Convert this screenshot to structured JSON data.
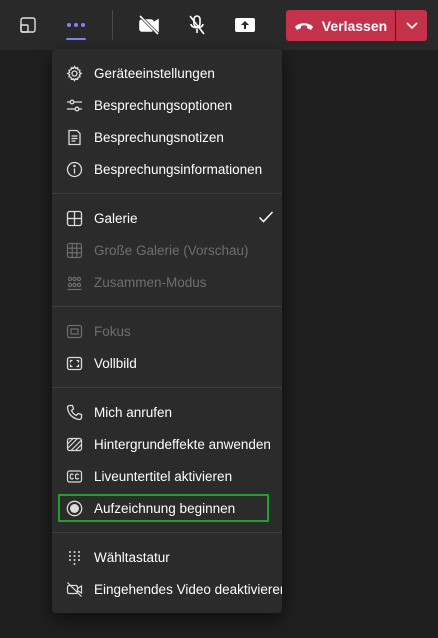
{
  "toolbar": {
    "leave_label": "Verlassen",
    "accent_color": "#7f85f5",
    "leave_color": "#c4314b",
    "icons": [
      "share-screen-icon",
      "more-options-icon",
      "camera-off-icon",
      "mic-off-icon",
      "share-tray-icon",
      "phone-hangup-icon",
      "chevron-down-icon"
    ]
  },
  "menu": {
    "groups": [
      [
        {
          "label": "Geräteeinstellungen",
          "icon": "gear-icon",
          "disabled": false
        },
        {
          "label": "Besprechungsoptionen",
          "icon": "sliders-icon",
          "disabled": false
        },
        {
          "label": "Besprechungsnotizen",
          "icon": "notes-icon",
          "disabled": false
        },
        {
          "label": "Besprechungsinformationen",
          "icon": "info-icon",
          "disabled": false
        }
      ],
      [
        {
          "label": "Galerie",
          "icon": "grid-icon",
          "disabled": false,
          "checked": true
        },
        {
          "label": "Große Galerie (Vorschau)",
          "icon": "large-grid-icon",
          "disabled": true
        },
        {
          "label": "Zusammen-Modus",
          "icon": "people-icon",
          "disabled": true
        }
      ],
      [
        {
          "label": "Fokus",
          "icon": "focus-icon",
          "disabled": true
        },
        {
          "label": "Vollbild",
          "icon": "fullscreen-icon",
          "disabled": false
        }
      ],
      [
        {
          "label": "Mich anrufen",
          "icon": "phone-icon",
          "disabled": false
        },
        {
          "label": "Hintergrundeffekte anwenden",
          "icon": "background-effects-icon",
          "disabled": false
        },
        {
          "label": "Liveuntertitel aktivieren",
          "icon": "captions-icon",
          "disabled": false
        },
        {
          "label": "Aufzeichnung beginnen",
          "icon": "record-icon",
          "disabled": false,
          "highlighted": true
        }
      ],
      [
        {
          "label": "Wähltastatur",
          "icon": "dialpad-icon",
          "disabled": false
        },
        {
          "label": "Eingehendes Video deaktivieren",
          "icon": "video-off-icon",
          "disabled": false
        }
      ]
    ]
  },
  "highlight_color": "#21a02e"
}
